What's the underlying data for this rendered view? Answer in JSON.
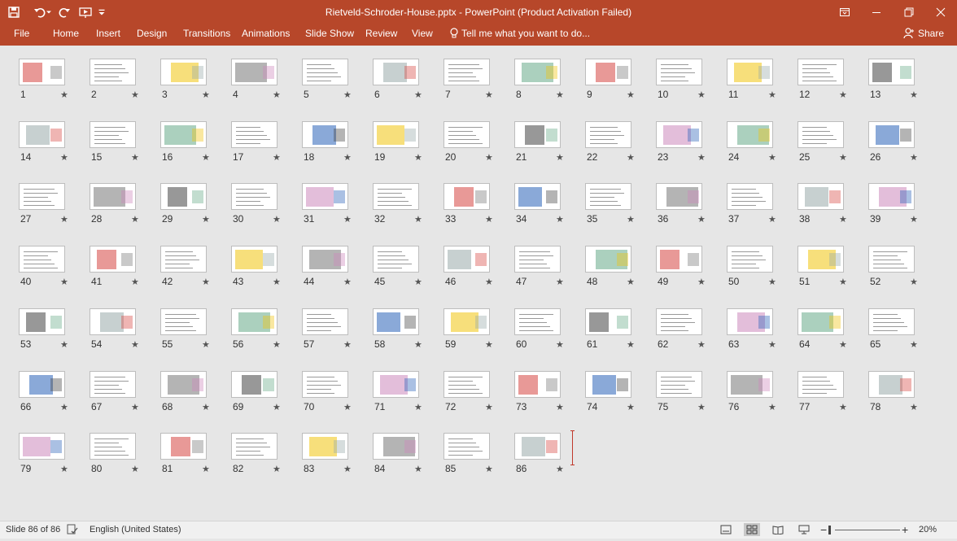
{
  "window": {
    "title": "Rietveld-Schroder-House.pptx - PowerPoint (Product Activation Failed)",
    "accent": "#b7472a"
  },
  "qat_icons": [
    "save-icon",
    "undo-icon",
    "undo-dropdown-icon",
    "redo-icon",
    "start-from-beginning-icon",
    "customize-qat-icon"
  ],
  "window_icons": [
    "ribbon-display-options-icon",
    "minimize-icon",
    "restore-icon",
    "close-icon"
  ],
  "ribbon": {
    "file": "File",
    "tabs": [
      "Home",
      "Insert",
      "Design",
      "Transitions",
      "Animations",
      "Slide Show",
      "Review",
      "View"
    ],
    "tell_me": "Tell me what you want to do...",
    "share": "Share"
  },
  "slides": {
    "count": 86,
    "selected": 86,
    "star_glyph": "★"
  },
  "status": {
    "slide_indicator": "Slide 86 of 86",
    "language": "English (United States)",
    "zoom": "20%",
    "zoom_out": "−",
    "zoom_in": "+",
    "view_buttons": [
      "notes-icon",
      "slide-sorter-icon",
      "reading-view-icon",
      "slide-show-icon"
    ],
    "active_view": "slide-sorter-icon"
  }
}
